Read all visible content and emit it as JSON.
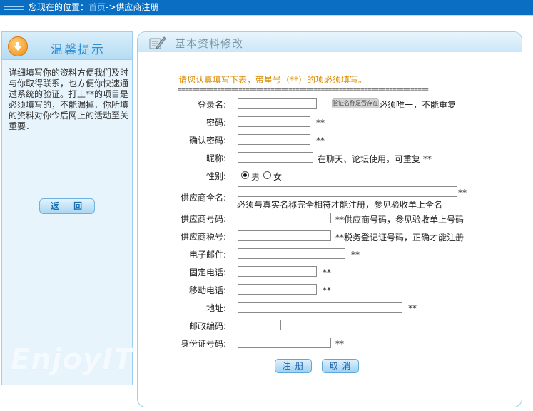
{
  "breadcrumb": {
    "prefix": "您现在的位置：",
    "home": "首页",
    "arrow": "->",
    "current": "供应商注册"
  },
  "left_panel": {
    "title": "温馨提示",
    "text": "详细填写你的资料方便我们及时与你取得联系，也方便你快速通过系统的验证。打上**的项目是必须填写的，不能漏掉．你所填的资料对你今后网上的活动至关重要．",
    "back_label": "返 回",
    "watermark": "EnjoyIT"
  },
  "form": {
    "title": "基本资料修改",
    "notice": "请您认真填写下表，带星号（**）的项必须填写。",
    "separator": "======================================================================",
    "verify_label": "验证名称是否存在",
    "fields": {
      "login": {
        "label": "登录名:",
        "value": "",
        "note": "必须唯一，不能重复"
      },
      "password": {
        "label": "密码:",
        "value": "",
        "note": "**"
      },
      "confirm": {
        "label": "确认密码:",
        "value": "",
        "note": "**"
      },
      "nickname": {
        "label": "昵称:",
        "value": "",
        "note": "在聊天、论坛使用，可重复 **"
      },
      "gender": {
        "label": "性别:",
        "male": "男",
        "female": "女",
        "selected": "男"
      },
      "fullname": {
        "label": "供应商全名:",
        "value": "",
        "stars": "**",
        "note": "必须与真实名称完全相符才能注册，参见验收单上全名"
      },
      "code": {
        "label": "供应商号码:",
        "value": "",
        "note": "**供应商号码，参见验收单上号码"
      },
      "tax": {
        "label": "供应商税号:",
        "value": "",
        "note": "**税务登记证号码，正确才能注册"
      },
      "email": {
        "label": "电子邮件:",
        "value": "",
        "note": "**"
      },
      "phone": {
        "label": "固定电话:",
        "value": "",
        "note": "**"
      },
      "mobile": {
        "label": "移动电话:",
        "value": "",
        "note": "**"
      },
      "address": {
        "label": "地址:",
        "value": "",
        "note": "**"
      },
      "postcode": {
        "label": "邮政编码:",
        "value": ""
      },
      "idcard": {
        "label": "身份证号码:",
        "value": "",
        "note": "**"
      }
    },
    "submit_label": "注册",
    "cancel_label": "取消"
  }
}
